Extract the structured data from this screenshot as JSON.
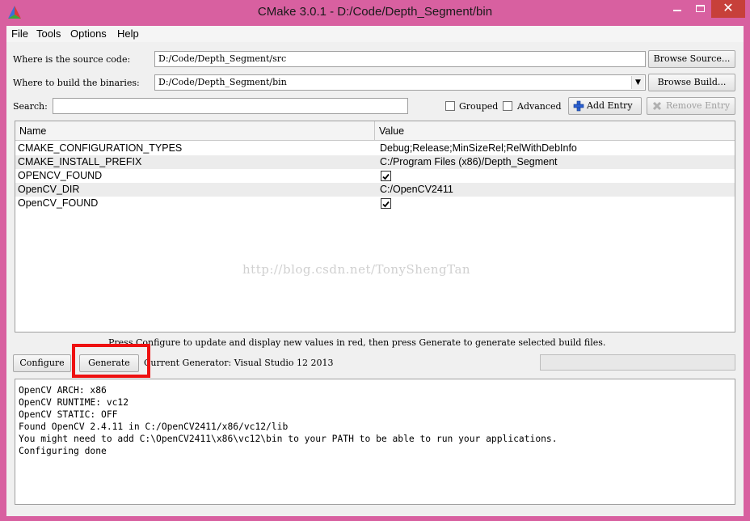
{
  "window": {
    "title": "CMake 3.0.1 - D:/Code/Depth_Segment/bin",
    "close_label": "✕"
  },
  "menu": [
    "File",
    "Tools",
    "Options",
    "Help"
  ],
  "source": {
    "label": "Where is the source code:",
    "value": "D:/Code/Depth_Segment/src",
    "browse_label": "Browse Source..."
  },
  "binaries": {
    "label": "Where to build the binaries:",
    "value": "D:/Code/Depth_Segment/bin",
    "browse_label": "Browse Build..."
  },
  "search": {
    "label": "Search:",
    "value": ""
  },
  "options": {
    "grouped_label": "Grouped",
    "advanced_label": "Advanced",
    "add_entry_label": "Add Entry",
    "remove_entry_label": "Remove Entry"
  },
  "table": {
    "headers": [
      "Name",
      "Value"
    ],
    "rows": [
      {
        "name": "CMAKE_CONFIGURATION_TYPES",
        "value": "Debug;Release;MinSizeRel;RelWithDebInfo",
        "checkbox": false
      },
      {
        "name": "CMAKE_INSTALL_PREFIX",
        "value": "C:/Program Files (x86)/Depth_Segment",
        "checkbox": false
      },
      {
        "name": "OPENCV_FOUND",
        "value": "",
        "checkbox": true
      },
      {
        "name": "OpenCV_DIR",
        "value": "C:/OpenCV2411",
        "checkbox": false
      },
      {
        "name": "OpenCV_FOUND",
        "value": "",
        "checkbox": true
      }
    ]
  },
  "watermark": "http://blog.csdn.net/TonyShengTan",
  "hint": "Press Configure to update and display new values in red, then press Generate to generate selected build files.",
  "actions": {
    "configure_label": "Configure",
    "generate_label": "Generate",
    "generator_text": "Current Generator: Visual Studio 12 2013"
  },
  "output_lines": [
    "OpenCV ARCH: x86",
    "OpenCV RUNTIME: vc12",
    "OpenCV STATIC: OFF",
    "Found OpenCV 2.4.11 in C:/OpenCV2411/x86/vc12/lib",
    "You might need to add C:\\OpenCV2411\\x86\\vc12\\bin to your PATH to be able to run your applications.",
    "Configuring done"
  ],
  "colors": {
    "window_frame": "#d860a0",
    "close_button": "#c7403a",
    "highlight_box": "#ee1111"
  }
}
